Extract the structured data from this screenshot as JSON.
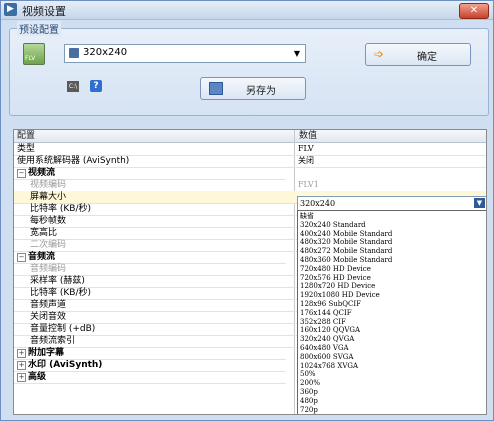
{
  "window": {
    "title": "视频设置",
    "close_label": "✕"
  },
  "preset": {
    "legend": "预设配置",
    "combo_value": "320x240",
    "ok_label": "确定",
    "saveas_label": "另存为"
  },
  "grid": {
    "col_config": "配置",
    "col_value": "数值",
    "rows": [
      {
        "name": "类型",
        "value": "FLV",
        "kind": "plain"
      },
      {
        "name": "使用系统解码器 (AviSynth)",
        "value": "关闭",
        "kind": "plain"
      },
      {
        "name": "视频流",
        "value": "",
        "kind": "cat",
        "exp": "⊟"
      },
      {
        "name": "视频编码",
        "value": "FLV1",
        "kind": "sub-gray"
      },
      {
        "name": "屏幕大小",
        "value": "",
        "kind": "sub-selected"
      },
      {
        "name": "比特率 (KB/秒)",
        "value": "",
        "kind": "sub"
      },
      {
        "name": "每秒帧数",
        "value": "",
        "kind": "sub"
      },
      {
        "name": "宽高比",
        "value": "",
        "kind": "sub"
      },
      {
        "name": "二次编码",
        "value": "",
        "kind": "sub-gray"
      },
      {
        "name": "音频流",
        "value": "",
        "kind": "cat",
        "exp": "⊟"
      },
      {
        "name": "音频编码",
        "value": "",
        "kind": "sub-gray"
      },
      {
        "name": "采样率 (赫兹)",
        "value": "",
        "kind": "sub"
      },
      {
        "name": "比特率 (KB/秒)",
        "value": "",
        "kind": "sub"
      },
      {
        "name": "音频声道",
        "value": "",
        "kind": "sub"
      },
      {
        "name": "关闭音效",
        "value": "",
        "kind": "sub"
      },
      {
        "name": "音量控制 (+dB)",
        "value": "",
        "kind": "sub"
      },
      {
        "name": "音频流索引",
        "value": "",
        "kind": "sub"
      },
      {
        "name": "附加字幕",
        "value": "",
        "kind": "cat",
        "exp": "⊞"
      },
      {
        "name": "水印 (AviSynth)",
        "value": "",
        "kind": "cat",
        "exp": "⊞"
      },
      {
        "name": "高级",
        "value": "",
        "kind": "cat",
        "exp": "⊞"
      }
    ]
  },
  "screen_size": {
    "current": "320x240",
    "options": [
      "缺省",
      "320x240  Standard",
      "400x240  Mobile Standard",
      "480x320  Mobile Standard",
      "480x272  Mobile Standard",
      "480x360  Mobile Standard",
      "720x480  HD Device",
      "720x576  HD Device",
      "1280x720 HD Device",
      "1920x1080 HD Device",
      "128x96   SubQCIF",
      "176x144  QCIF",
      "352x288  CIF",
      "160x120  QQVGA",
      "320x240  QVGA",
      "640x480  VGA",
      "800x600  SVGA",
      "1024x768 XVGA",
      "50%",
      "200%",
      "360p",
      "480p",
      "720p"
    ]
  }
}
